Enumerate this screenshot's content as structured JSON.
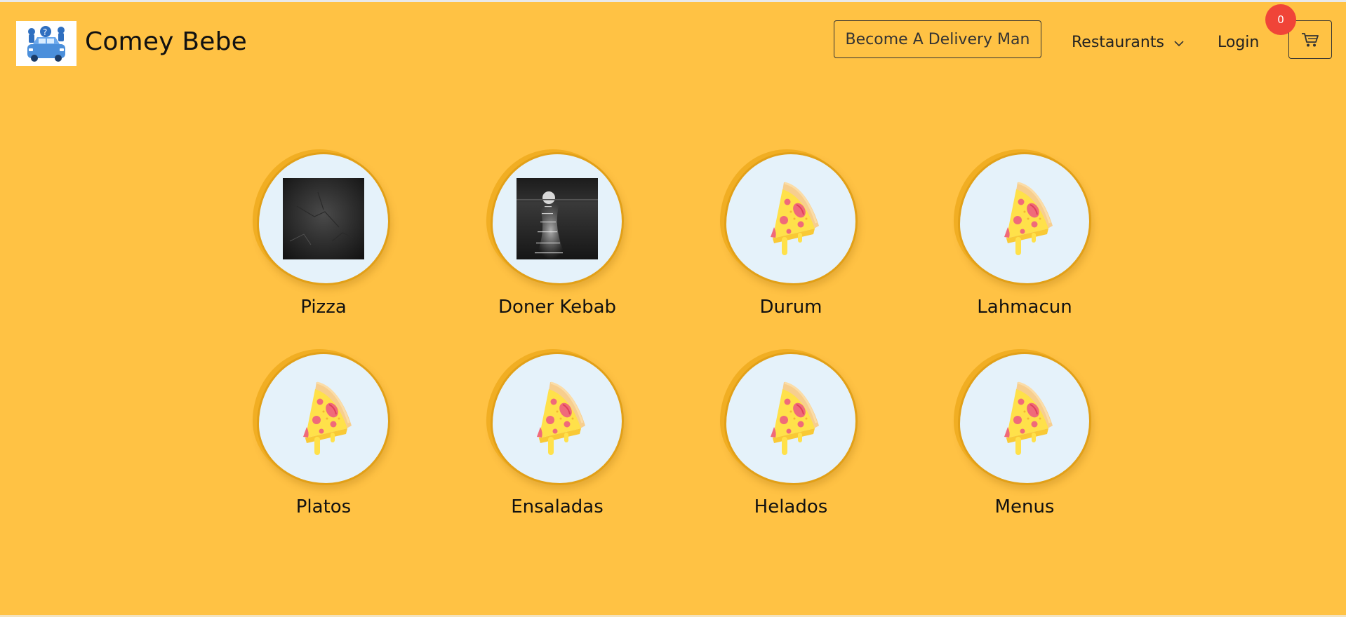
{
  "header": {
    "brand": "Comey Bebe",
    "delivery_button": "Become A Delivery Man",
    "restaurants_menu": "Restaurants",
    "login": "Login",
    "cart_count": "0"
  },
  "categories": [
    {
      "label": "Pizza",
      "image": "dark-texture-photo"
    },
    {
      "label": "Doner Kebab",
      "image": "moonlit-sea-photo"
    },
    {
      "label": "Durum",
      "image": "pizza-slice-icon"
    },
    {
      "label": "Lahmacun",
      "image": "pizza-slice-icon"
    },
    {
      "label": "Platos",
      "image": "pizza-slice-icon"
    },
    {
      "label": "Ensaladas",
      "image": "pizza-slice-icon"
    },
    {
      "label": "Helados",
      "image": "pizza-slice-icon"
    },
    {
      "label": "Menus",
      "image": "pizza-slice-icon"
    }
  ],
  "colors": {
    "background": "#FFC244",
    "badge": "#F04438",
    "circle_fill": "#E5F2FA",
    "circle_border": "#E2A018"
  }
}
